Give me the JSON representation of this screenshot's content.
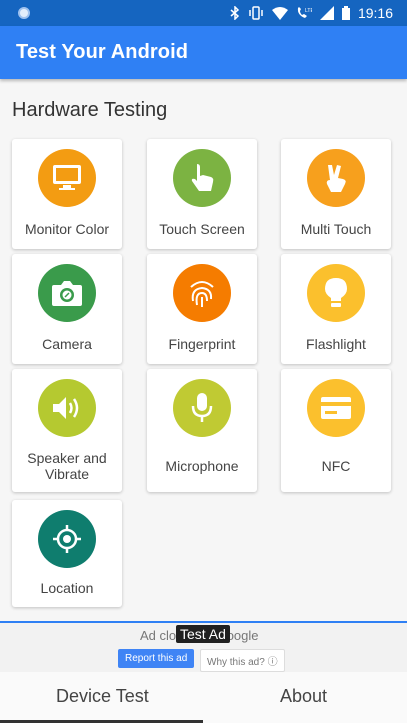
{
  "status_bar": {
    "time": "19:16",
    "icons": [
      "notification-dot-icon",
      "bluetooth-icon",
      "vibrate-icon",
      "wifi-icon",
      "volte-call-icon",
      "cell-signal-icon",
      "battery-icon"
    ]
  },
  "app_bar": {
    "title": "Test Your Android"
  },
  "section": {
    "title": "Hardware Testing"
  },
  "tiles": [
    {
      "label": "Monitor Color",
      "icon": "monitor-icon",
      "color": "#f39c12"
    },
    {
      "label": "Touch Screen",
      "icon": "touch-icon",
      "color": "#7cb342"
    },
    {
      "label": "Multi Touch",
      "icon": "multi-touch-icon",
      "color": "#f7a01d"
    },
    {
      "label": "Camera",
      "icon": "camera-icon",
      "color": "#3a9b4b"
    },
    {
      "label": "Fingerprint",
      "icon": "fingerprint-icon",
      "color": "#f57c00"
    },
    {
      "label": "Flashlight",
      "icon": "lightbulb-icon",
      "color": "#fbc02d"
    },
    {
      "label": "Speaker and Vibrate",
      "icon": "speaker-icon",
      "color": "#b5c930"
    },
    {
      "label": "Microphone",
      "icon": "microphone-icon",
      "color": "#c0ca33"
    },
    {
      "label": "NFC",
      "icon": "card-icon",
      "color": "#fbc02d"
    },
    {
      "label": "Location",
      "icon": "location-icon",
      "color": "#0f7d6e"
    }
  ],
  "ad": {
    "text": "Ad closed by Google",
    "badge": "Test Ad",
    "report_label": "Report this ad",
    "why_label": "Why this ad? ⓘ"
  },
  "bottom_nav": {
    "items": [
      {
        "label": "Device Test"
      },
      {
        "label": "About"
      }
    ],
    "selected": "Device Test"
  },
  "colors": {
    "status_bar": "#1565c0",
    "app_bar": "#2f80f4",
    "background": "#f6f6f6"
  }
}
